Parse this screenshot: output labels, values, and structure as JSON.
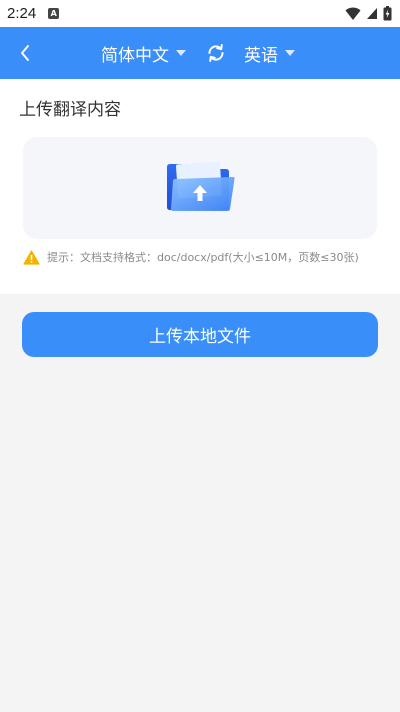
{
  "status_bar": {
    "time": "2:24",
    "app_icon_letter": "A"
  },
  "header": {
    "source_language": "简体中文",
    "target_language": "英语"
  },
  "main": {
    "section_title": "上传翻译内容",
    "hint_text": "提示：文档支持格式：doc/docx/pdf(大小≤10M，页数≤30张)",
    "upload_button_label": "上传本地文件"
  },
  "colors": {
    "accent": "#3a8ef9",
    "page_background": "#f4f4f5",
    "upload_area": "#f5f6f9",
    "warning": "#f3b400"
  },
  "icons": {
    "back": "chevron-left-icon",
    "swap": "swap-arrows-icon",
    "folder": "upload-folder-icon",
    "warning": "warning-icon",
    "wifi": "wifi-icon",
    "signal": "signal-icon",
    "battery": "battery-icon"
  }
}
